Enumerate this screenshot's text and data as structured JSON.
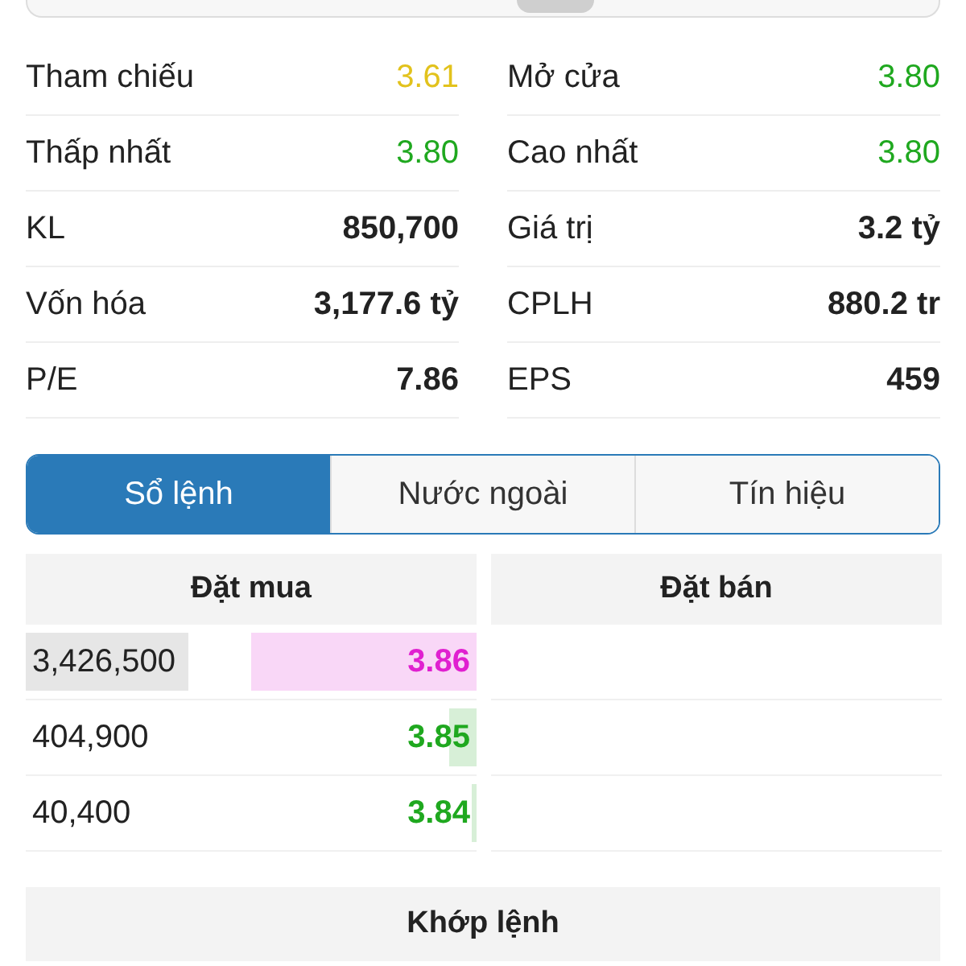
{
  "stats": [
    {
      "label": "Tham chiếu",
      "value": "3.61",
      "color": "#e2c21c",
      "bold": false
    },
    {
      "label": "Mở cửa",
      "value": "3.80",
      "color": "#1fa81f",
      "bold": false
    },
    {
      "label": "Thấp nhất",
      "value": "3.80",
      "color": "#1fa81f",
      "bold": false
    },
    {
      "label": "Cao nhất",
      "value": "3.80",
      "color": "#1fa81f",
      "bold": false
    },
    {
      "label": "KL",
      "value": "850,700",
      "color": "#222222",
      "bold": true
    },
    {
      "label": "Giá trị",
      "value": "3.2 tỷ",
      "color": "#222222",
      "bold": true
    },
    {
      "label": "Vốn hóa",
      "value": "3,177.6 tỷ",
      "color": "#222222",
      "bold": true
    },
    {
      "label": "CPLH",
      "value": "880.2 tr",
      "color": "#222222",
      "bold": true
    },
    {
      "label": "P/E",
      "value": "7.86",
      "color": "#222222",
      "bold": true
    },
    {
      "label": "EPS",
      "value": "459",
      "color": "#222222",
      "bold": true
    }
  ],
  "tabs": [
    {
      "label": "Sổ lệnh",
      "selected": true
    },
    {
      "label": "Nước ngoài",
      "selected": false
    },
    {
      "label": "Tín hiệu",
      "selected": false
    }
  ],
  "order_book": {
    "buy_header": "Đặt mua",
    "sell_header": "Đặt bán",
    "bids": [
      {
        "volume": "3,426,500",
        "volume_bar": {
          "level": 0.36
        },
        "price": "3.86",
        "color": "#e020d0",
        "price_bar": {
          "level": 0.5
        }
      },
      {
        "volume": "404,900",
        "price": "3.85",
        "color": "#1fa81f",
        "price_bar": {
          "level": 0.06
        }
      },
      {
        "volume": "40,400",
        "price": "3.84",
        "color": "#1fa81f",
        "price_bar": {
          "level": 0.01
        }
      }
    ]
  },
  "matched_header": "Khớp lệnh"
}
